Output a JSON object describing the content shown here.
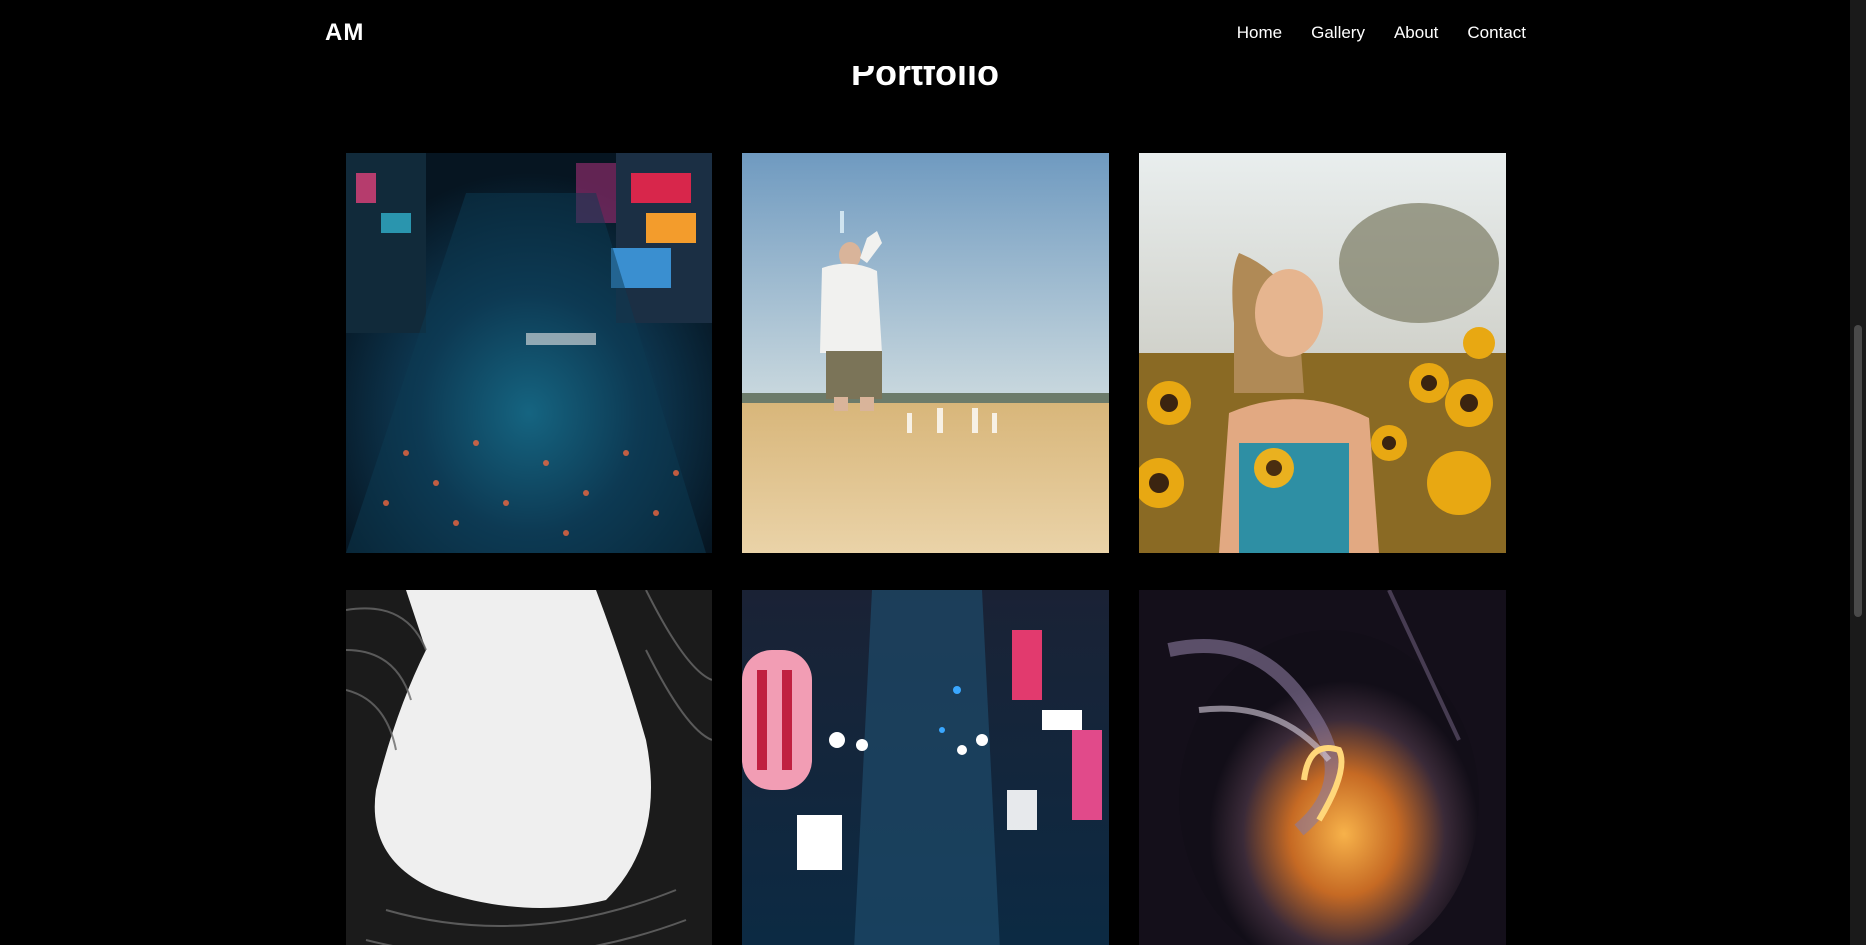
{
  "header": {
    "logo": "AM",
    "nav": [
      {
        "label": "Home"
      },
      {
        "label": "Gallery"
      },
      {
        "label": "About"
      },
      {
        "label": "Contact"
      }
    ]
  },
  "main": {
    "title": "Portfolio"
  },
  "gallery": {
    "items": [
      {
        "subject": "aerial view of crowded city crossing at night"
      },
      {
        "subject": "man in white shirt drinking water on desert dune"
      },
      {
        "subject": "woman holding sunflower in sunflower field"
      },
      {
        "subject": "black and white curved building looking up"
      },
      {
        "subject": "neon-lit narrow alley at night"
      },
      {
        "subject": "abstract orange and purple ink swirl"
      }
    ]
  },
  "colors": {
    "background": "#000000",
    "text": "#ffffff",
    "scrollbar_track": "#1a1a1a",
    "scrollbar_thumb": "#4a4a4a"
  }
}
